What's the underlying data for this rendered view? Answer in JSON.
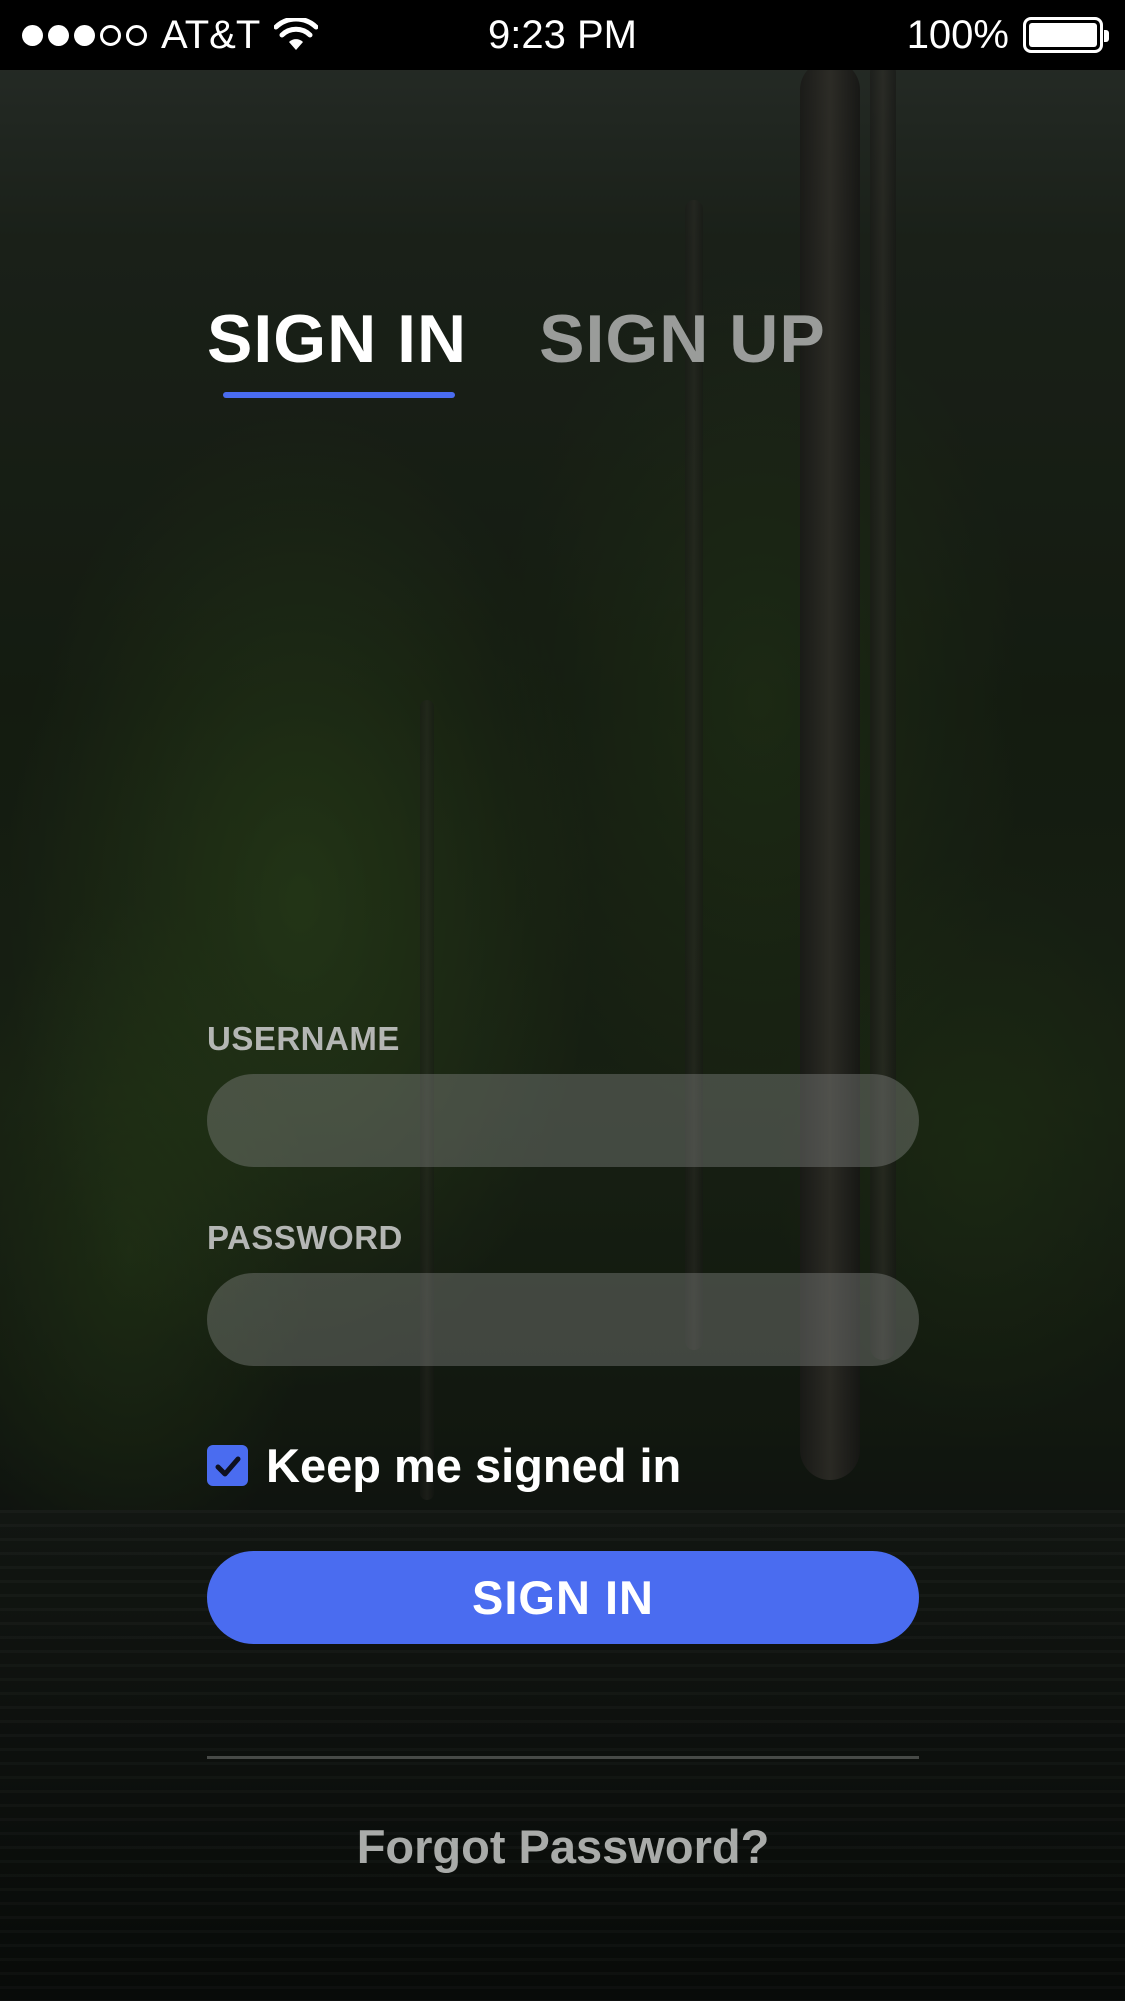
{
  "status_bar": {
    "carrier": "AT&T",
    "time": "9:23 PM",
    "battery_percent": "100%",
    "battery_level": 1.0,
    "signal_bars_filled": 3,
    "signal_bars_total": 5
  },
  "tabs": [
    {
      "label": "SIGN IN",
      "active": true
    },
    {
      "label": "SIGN UP",
      "active": false
    }
  ],
  "form": {
    "username_label": "USERNAME",
    "username_value": "",
    "password_label": "PASSWORD",
    "password_value": "",
    "remember_label": "Keep me signed in",
    "remember_checked": true,
    "submit_label": "SIGN IN",
    "forgot_label": "Forgot Password?"
  },
  "colors": {
    "accent": "#4a6cf0",
    "status_bar_bg": "#000000",
    "inactive_tab": "#9a9c9a"
  }
}
